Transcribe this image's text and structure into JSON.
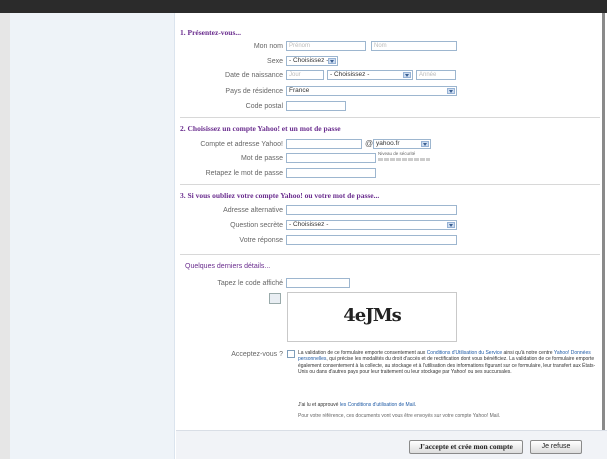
{
  "sections": {
    "s1": "1. Présentez-vous...",
    "s2": "2. Choisissez un compte Yahoo! et un mot de passe",
    "s3": "3. Si vous oubliez votre compte Yahoo! ou votre mot de passe...",
    "s4": "Quelques derniers détails..."
  },
  "form": {
    "nom_label": "Mon nom",
    "prenom_placeholder": "Prénom",
    "nom_placeholder": "Nom",
    "sexe_label": "Sexe",
    "sexe_value": "- Choisissez -",
    "naissance_label": "Date de naissance",
    "jour_placeholder": "Jour",
    "mois_value": "- Choisissez -",
    "annee_placeholder": "Année",
    "pays_label": "Pays de résidence",
    "pays_value": "France",
    "cp_label": "Code postal",
    "compte_label": "Compte et adresse Yahoo!",
    "at": "@",
    "domaine_value": "yahoo.fr",
    "mdp_label": "Mot de passe",
    "securite_label": "Niveau de sécurité",
    "retape_label": "Retapez le mot de passe",
    "alt_label": "Adresse alternative",
    "question_label": "Question secrète",
    "question_value": "- Choisissez -",
    "reponse_label": "Votre réponse",
    "code_label": "Tapez le code affiché",
    "captcha_text": "4eJMs",
    "accept_label": "Acceptez-vous ?"
  },
  "legal": {
    "p1_a": "La validation de ce formulaire emporte consentement aux ",
    "p1_link1": "Conditions d'Utilisation du Service",
    "p1_b": " ainsi qu'à notre centre ",
    "p1_link2": "Yahoo! Données personnelles",
    "p1_c": ", qui précise les modalités du droit d'accès et de rectification dont vous bénéficiez. La validation de ce formulaire emporte également consentement à la collecte, au stockage et à l'utilisation des informations figurant sur ce formulaire, leur transfert aux États-Unis ou dans d'autres pays pour leur traitement ou leur stockage par Yahoo! ou ses succursales.",
    "p2_a": "J'ai lu et approuvé ",
    "p2_link": "les Conditions d'utilisation de Mail",
    "p2_b": ".",
    "p3": "Pour votre référence, ces documents vont vous être envoyés sur votre compte Yahoo! Mail."
  },
  "buttons": {
    "accept": "J'accepte et crée mon compte",
    "refuse": "Je refuse"
  }
}
